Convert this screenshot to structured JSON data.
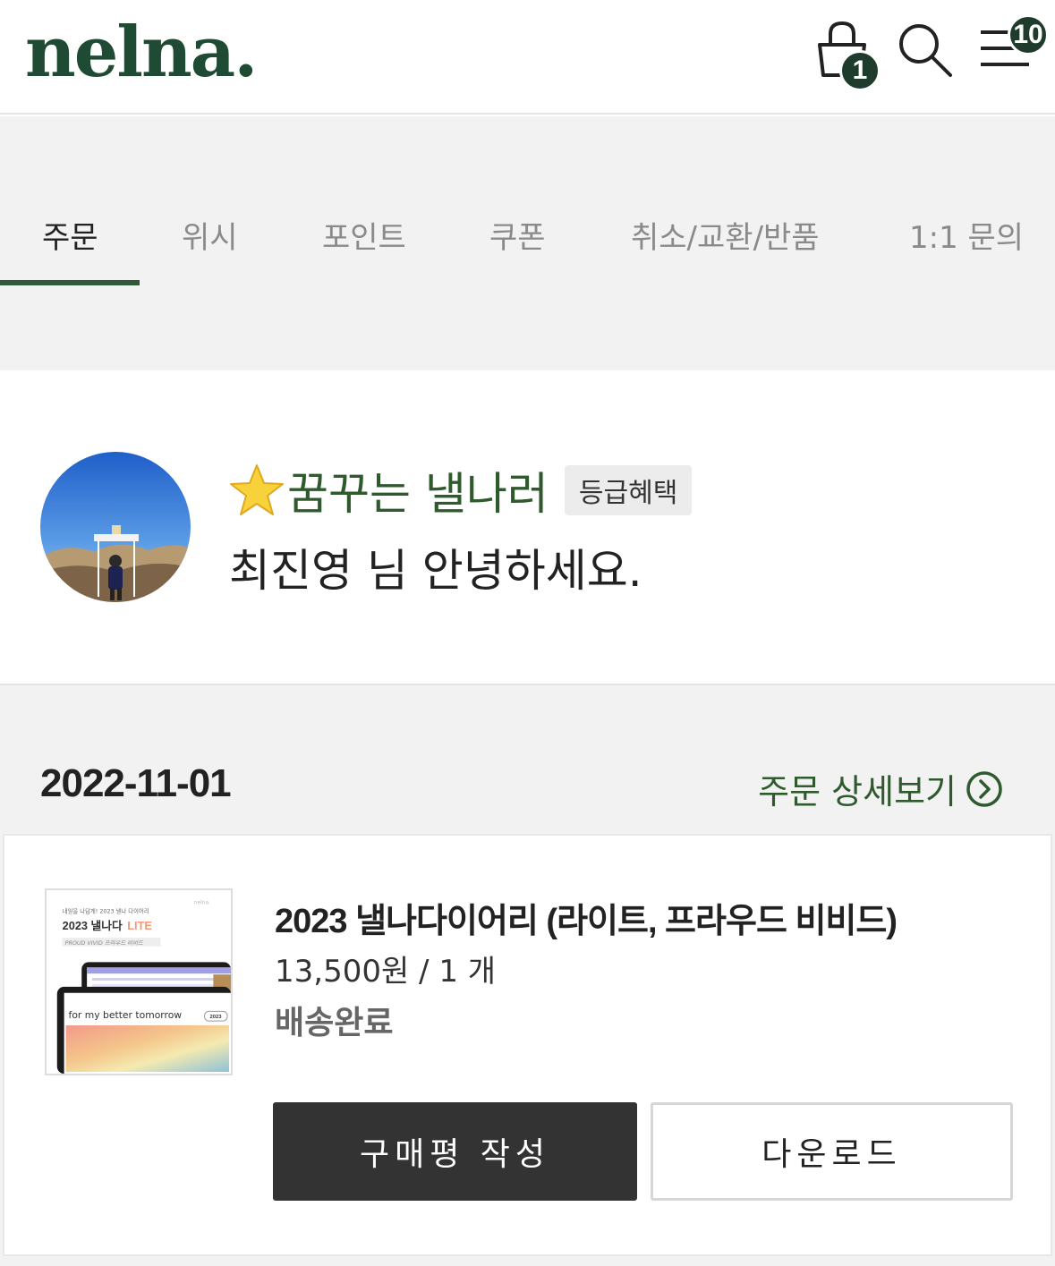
{
  "header": {
    "logo": "nelna.",
    "cart_count": "1",
    "menu_badge": "10"
  },
  "tabs": [
    {
      "label": "주문",
      "active": true
    },
    {
      "label": "위시"
    },
    {
      "label": "포인트"
    },
    {
      "label": "쿠폰"
    },
    {
      "label": "취소/교환/반품"
    },
    {
      "label": "1:1 문의"
    }
  ],
  "profile": {
    "grade_name": "꿈꾸는 낼나러",
    "grade_benefit_label": "등급혜택",
    "greeting": "최진영 님 안녕하세요."
  },
  "order": {
    "date": "2022-11-01",
    "detail_link": "주문 상세보기",
    "product": {
      "title": "2023 낼나다이어리 (라이트, 프라우드 비비드)",
      "price_qty": "13,500원 / 1 개",
      "status": "배송완료",
      "thumbnail_text": {
        "top": "내일을 나답게! 2023 낼나 다이어리",
        "brand_small": "nelna.",
        "headline": "2023 낼나다",
        "headline_accent": "LITE",
        "sub": "PROUD VIVID 프라우드 비비드",
        "tagline": "for my better tomorrow",
        "year": "2023"
      }
    },
    "review_button": "구매평 작성",
    "download_button": "다운로드"
  },
  "colors": {
    "brand_green": "#1f4a33",
    "accent_green": "#2e5a2e",
    "dark_button": "#333333"
  }
}
